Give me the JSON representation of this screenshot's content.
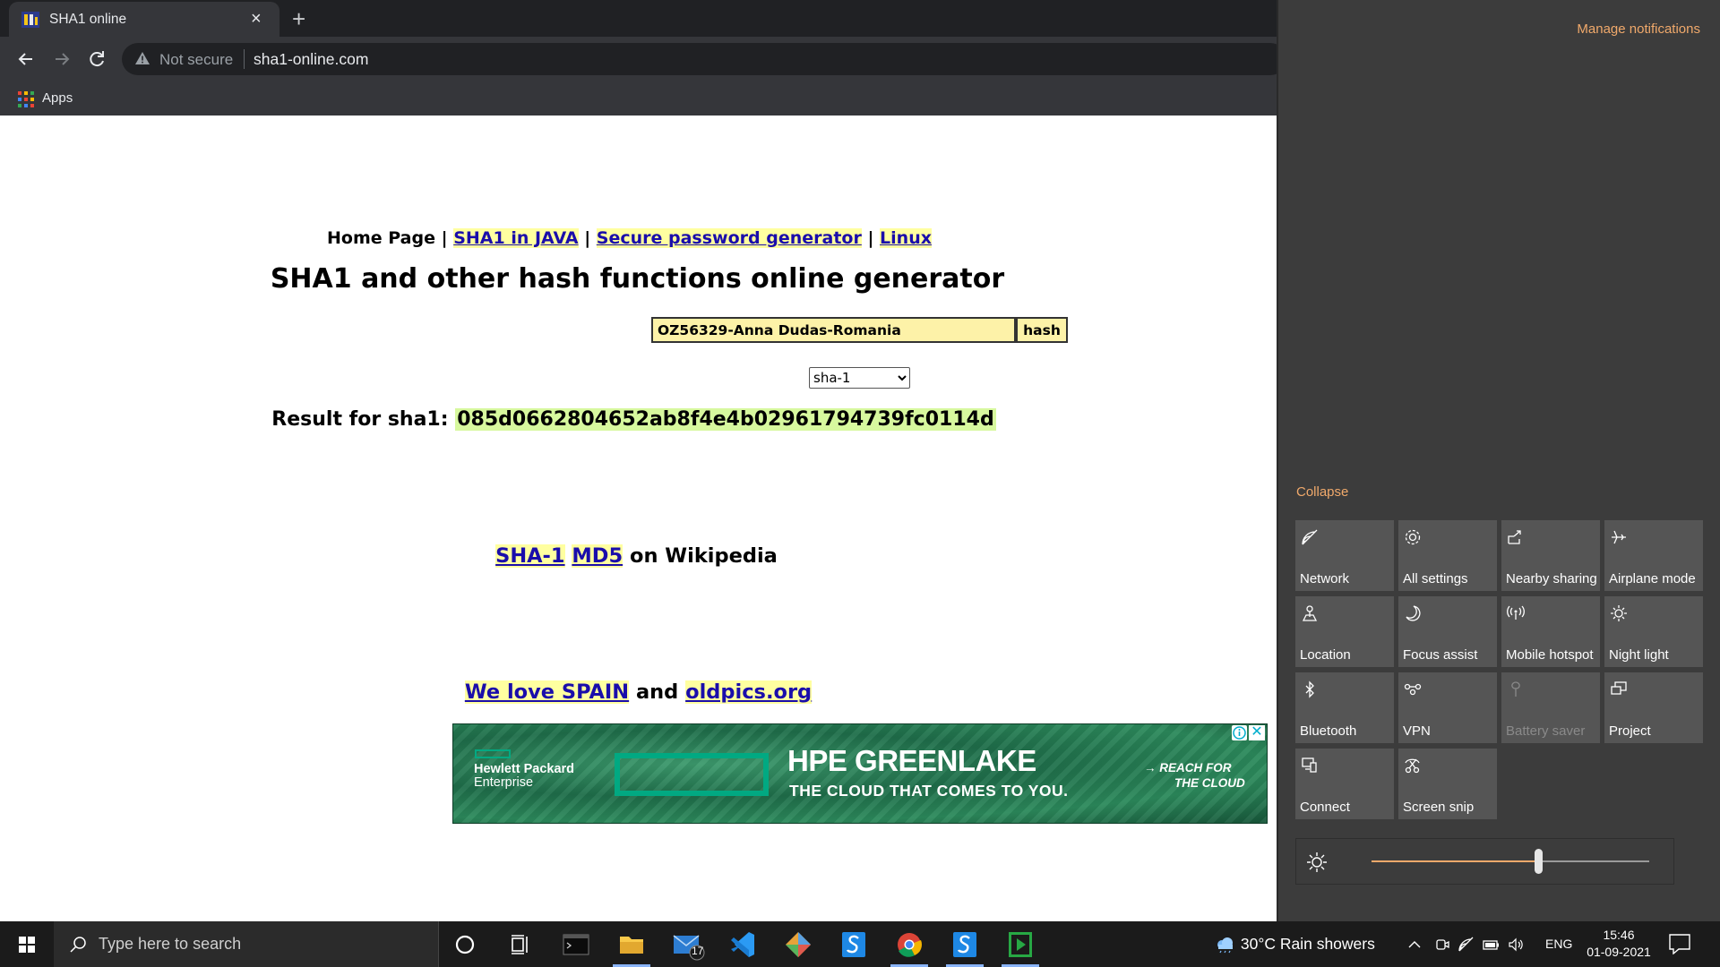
{
  "browser": {
    "tab_title": "SHA1 online",
    "tab_close": "×",
    "new_tab": "+",
    "security_label": "Not secure",
    "url": "sha1-online.com",
    "bookmark_apps": "Apps"
  },
  "page": {
    "nav": {
      "home": "Home Page",
      "sep": "|",
      "link_java": "SHA1 in JAVA",
      "link_password": "Secure password generator",
      "link_linux": "Linux"
    },
    "title": "SHA1 and other hash functions online generator",
    "input_value": "OZ56329-Anna Dudas-Romania",
    "hash_button": "hash",
    "algorithm_selected": "sha-1",
    "result_label": "Result for sha1:",
    "result_value": "085d0662804652ab8f4e4b02961794739fc0114d",
    "wiki": {
      "link_sha1": "SHA-1",
      "link_md5": "MD5",
      "suffix": "on Wikipedia"
    },
    "love": {
      "link_spain": "We love SPAIN",
      "and": "and",
      "link_oldpics": "oldpics.org"
    },
    "ad": {
      "company_line1": "Hewlett Packard",
      "company_line2": "Enterprise",
      "headline": "HPE GREENLAKE",
      "tagline": "THE CLOUD THAT COMES TO YOU.",
      "cta_line1": "→ REACH FOR",
      "cta_line2": "THE CLOUD",
      "close": "✕"
    }
  },
  "action_center": {
    "manage_notifications": "Manage notifications",
    "collapse": "Collapse",
    "tiles": [
      {
        "label": "Network",
        "icon": "network-icon",
        "enabled": true
      },
      {
        "label": "All settings",
        "icon": "gear-icon",
        "enabled": true
      },
      {
        "label": "Nearby sharing",
        "icon": "share-icon",
        "enabled": true
      },
      {
        "label": "Airplane mode",
        "icon": "airplane-icon",
        "enabled": true
      },
      {
        "label": "Location",
        "icon": "location-icon",
        "enabled": true
      },
      {
        "label": "Focus assist",
        "icon": "moon-icon",
        "enabled": true
      },
      {
        "label": "Mobile hotspot",
        "icon": "hotspot-icon",
        "enabled": true
      },
      {
        "label": "Night light",
        "icon": "sun-icon",
        "enabled": true
      },
      {
        "label": "Bluetooth",
        "icon": "bluetooth-icon",
        "enabled": true
      },
      {
        "label": "VPN",
        "icon": "vpn-icon",
        "enabled": true
      },
      {
        "label": "Battery saver",
        "icon": "battery-saver-icon",
        "enabled": false
      },
      {
        "label": "Project",
        "icon": "project-icon",
        "enabled": true
      },
      {
        "label": "Connect",
        "icon": "connect-icon",
        "enabled": true
      },
      {
        "label": "Screen snip",
        "icon": "scissors-icon",
        "enabled": true
      }
    ],
    "brightness_level": 0.6,
    "accent_color": "#f0a96b"
  },
  "taskbar": {
    "search_placeholder": "Type here to search",
    "mail_badge": "17",
    "weather": "30°C  Rain showers",
    "language": "ENG",
    "time": "15:46",
    "date": "01-09-2021"
  }
}
